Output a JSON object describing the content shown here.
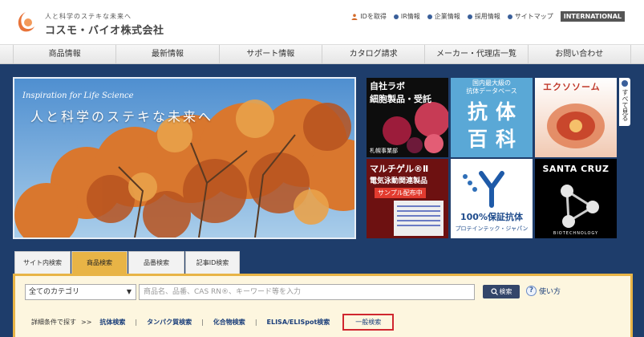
{
  "header": {
    "tagline": "人と科学のステキな未来へ",
    "company": "コスモ・バイオ株式会社",
    "links": [
      {
        "label": "IDを取得",
        "icon": "person-icon"
      },
      {
        "label": "IR情報",
        "icon": "bullet-icon"
      },
      {
        "label": "企業情報",
        "icon": "bullet-icon"
      },
      {
        "label": "採用情報",
        "icon": "bullet-icon"
      },
      {
        "label": "サイトマップ",
        "icon": "bullet-icon"
      }
    ],
    "international": "INTERNATIONAL"
  },
  "nav": [
    "商品情報",
    "最新情報",
    "サポート情報",
    "カタログ請求",
    "メーカー・代理店一覧",
    "お問い合わせ"
  ],
  "hero": {
    "english": "Inspiration for Life Science",
    "japanese": "人と科学のステキな未来へ"
  },
  "banners": {
    "b1": {
      "line1": "自社ラボ",
      "line2": "細胞製品・受託",
      "sub": "札幌事業部"
    },
    "b2": {
      "line1": "国内最大級の",
      "line2": "抗体データベース",
      "big1": "抗体",
      "big2": "百科"
    },
    "b3": {
      "title": "エクソソーム"
    },
    "b4": {
      "title": "マルチゲル®Ⅱ",
      "sub": "電気泳動関連製品",
      "badge": "サンプル配布中"
    },
    "b5": {
      "big": "100%保証抗体",
      "sub": "プロテインテック・ジャパン"
    },
    "b6": {
      "title": "SANTA CRUZ",
      "sub": "BIOTECHNOLOGY"
    }
  },
  "side_tab": "すべて見る",
  "search": {
    "tabs": [
      "サイト内検索",
      "商品検索",
      "品番検索",
      "記事ID検索"
    ],
    "active_tab": 1,
    "category": "全てのカテゴリ",
    "placeholder": "商品名、品番、CAS RN®、キーワード等を入力",
    "button": "検索",
    "help": "使い方",
    "adv_label": "詳細条件で探す",
    "adv_arrows": ">>",
    "adv_links": [
      "抗体検索",
      "タンパク質検索",
      "化合物検索",
      "ELISA/ELISpot検索"
    ],
    "adv_general": "一般検索"
  },
  "colors": {
    "main_bg": "#1e3d6b",
    "accent": "#e8b446",
    "highlight_border": "#d0272f",
    "link": "#1a3e7a"
  }
}
